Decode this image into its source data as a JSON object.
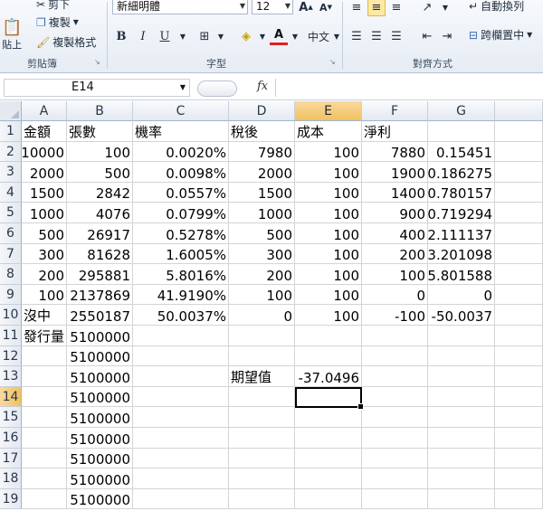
{
  "ribbon": {
    "clipboard": {
      "cut": "剪下",
      "copy": "複製",
      "format_painter": "複製格式",
      "paste": "貼上",
      "label": "剪貼簿"
    },
    "font": {
      "name": "新細明體",
      "size": "12",
      "bold": "B",
      "italic": "I",
      "underline": "U",
      "phonetic": "中文",
      "label": "字型"
    },
    "alignment": {
      "wrap_text": "自動換列",
      "merge_center": "跨欄置中",
      "label": "對齊方式"
    }
  },
  "formula_bar": {
    "name_box": "E14",
    "fx": "fx",
    "formula": ""
  },
  "sheet": {
    "columns": [
      "A",
      "B",
      "C",
      "D",
      "E",
      "F",
      "G"
    ],
    "selected_column": "E",
    "selected_row": 14,
    "rows": [
      {
        "n": "1",
        "cells": [
          "金額",
          "張數",
          "機率",
          "稅後",
          "成本",
          "淨利",
          ""
        ]
      },
      {
        "n": "2",
        "cells": [
          "10000",
          "100",
          "0.0020%",
          "7980",
          "100",
          "7880",
          "0.15451"
        ]
      },
      {
        "n": "3",
        "cells": [
          "2000",
          "500",
          "0.0098%",
          "2000",
          "100",
          "1900",
          "0.186275"
        ]
      },
      {
        "n": "4",
        "cells": [
          "1500",
          "2842",
          "0.0557%",
          "1500",
          "100",
          "1400",
          "0.780157"
        ]
      },
      {
        "n": "5",
        "cells": [
          "1000",
          "4076",
          "0.0799%",
          "1000",
          "100",
          "900",
          "0.719294"
        ]
      },
      {
        "n": "6",
        "cells": [
          "500",
          "26917",
          "0.5278%",
          "500",
          "100",
          "400",
          "2.111137"
        ]
      },
      {
        "n": "7",
        "cells": [
          "300",
          "81628",
          "1.6005%",
          "300",
          "100",
          "200",
          "3.201098"
        ]
      },
      {
        "n": "8",
        "cells": [
          "200",
          "295881",
          "5.8016%",
          "200",
          "100",
          "100",
          "5.801588"
        ]
      },
      {
        "n": "9",
        "cells": [
          "100",
          "2137869",
          "41.9190%",
          "100",
          "100",
          "0",
          "0"
        ]
      },
      {
        "n": "10",
        "cells": [
          "沒中",
          "2550187",
          "50.0037%",
          "0",
          "100",
          "-100",
          "-50.0037"
        ]
      },
      {
        "n": "11",
        "cells": [
          "發行量",
          "5100000",
          "",
          "",
          "",
          "",
          ""
        ]
      },
      {
        "n": "12",
        "cells": [
          "",
          "5100000",
          "",
          "",
          "",
          "",
          ""
        ]
      },
      {
        "n": "13",
        "cells": [
          "",
          "5100000",
          "",
          "期望值",
          "-37.0496",
          "",
          ""
        ]
      },
      {
        "n": "14",
        "cells": [
          "",
          "5100000",
          "",
          "",
          "",
          "",
          ""
        ]
      },
      {
        "n": "15",
        "cells": [
          "",
          "5100000",
          "",
          "",
          "",
          "",
          ""
        ]
      },
      {
        "n": "16",
        "cells": [
          "",
          "5100000",
          "",
          "",
          "",
          "",
          ""
        ]
      },
      {
        "n": "17",
        "cells": [
          "",
          "5100000",
          "",
          "",
          "",
          "",
          ""
        ]
      },
      {
        "n": "18",
        "cells": [
          "",
          "5100000",
          "",
          "",
          "",
          "",
          ""
        ]
      },
      {
        "n": "19",
        "cells": [
          "",
          "5100000",
          "",
          "",
          "",
          "",
          ""
        ]
      }
    ]
  }
}
